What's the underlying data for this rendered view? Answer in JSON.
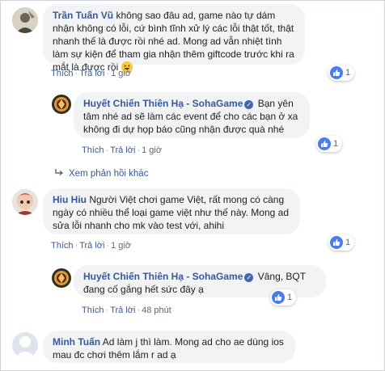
{
  "colors": {
    "link": "#385898",
    "bubble": "#f2f3f5",
    "like": "#4b7bec",
    "meta": "#606770"
  },
  "actions": {
    "like": "Thích",
    "reply": "Trả lời"
  },
  "comments": [
    {
      "author": "Trần Tuấn Vũ",
      "text": "không sao đâu ad, game nào tự dám nhận không có lỗi, cứ bình tĩnh xử lý các lỗi thật tốt, thật nhanh thế là được rồi nhé ad. Mong ad vẫn nhiệt tình làm sự kiện để tham gia nhận thêm giftcode trước khi ra mắt là được rồi",
      "emoji": "smile-emoji",
      "time": "1 giờ",
      "likes": "1"
    },
    {
      "author": "Huyết Chiến Thiên Hạ - SohaGame",
      "text": "Bạn yên tâm nhé ad sẽ làm các event để cho các bạn ở xa không đi dự họp báo cũng nhận được quà nhé",
      "time": "1 giờ",
      "likes": "1"
    },
    {
      "author": "Hiu Hiu",
      "text": "Người Việt chơi game Việt, rất mong có càng ngày có nhiều thể loại game việt như thế này. Mong ad sửa lỗi nhanh cho mk vào test với, ahihi",
      "time": "1 giờ",
      "likes": "1"
    },
    {
      "author": "Huyết Chiến Thiên Hạ - SohaGame",
      "text": "Vâng, BQT đang cố gắng hết sức đây ạ",
      "time": "48 phút",
      "likes": "1"
    },
    {
      "author": "Minh Tuấn",
      "text": "Ad làm j thì làm. Mong ad cho ae dùng ios mau đc chơi thêm lắm r ad ạ"
    }
  ],
  "view_more": "Xem phản hồi khác"
}
